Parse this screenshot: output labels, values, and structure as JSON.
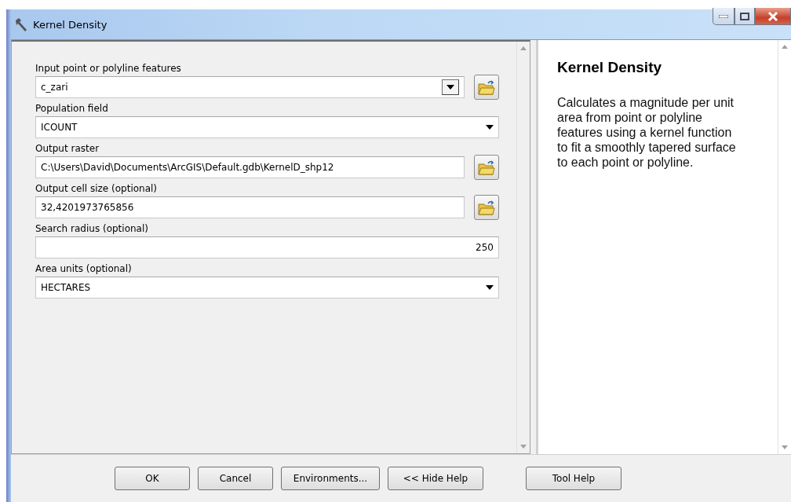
{
  "window": {
    "title": "Kernel Density"
  },
  "fields": [
    {
      "label": "Input point or polyline features",
      "value": "c_zari",
      "kind": "combo",
      "browse": true
    },
    {
      "label": "Population field",
      "value": "ICOUNT",
      "kind": "dropdown",
      "browse": false
    },
    {
      "label": "Output raster",
      "value": "C:\\Users\\David\\Documents\\ArcGIS\\Default.gdb\\KernelD_shp12",
      "kind": "text",
      "browse": true
    },
    {
      "label": "Output cell size (optional)",
      "value": "32,4201973765856",
      "kind": "text",
      "browse": true
    },
    {
      "label": "Search radius (optional)",
      "value": "250",
      "kind": "number",
      "browse": false
    },
    {
      "label": "Area units (optional)",
      "value": "HECTARES",
      "kind": "dropdown",
      "browse": false
    }
  ],
  "help": {
    "title": "Kernel Density",
    "text": "Calculates a magnitude per unit area from point or polyline features using a kernel function to fit a smoothly tapered surface to each point or polyline."
  },
  "buttons": [
    "OK",
    "Cancel",
    "Environments...",
    "<< Hide Help",
    "Tool Help"
  ]
}
